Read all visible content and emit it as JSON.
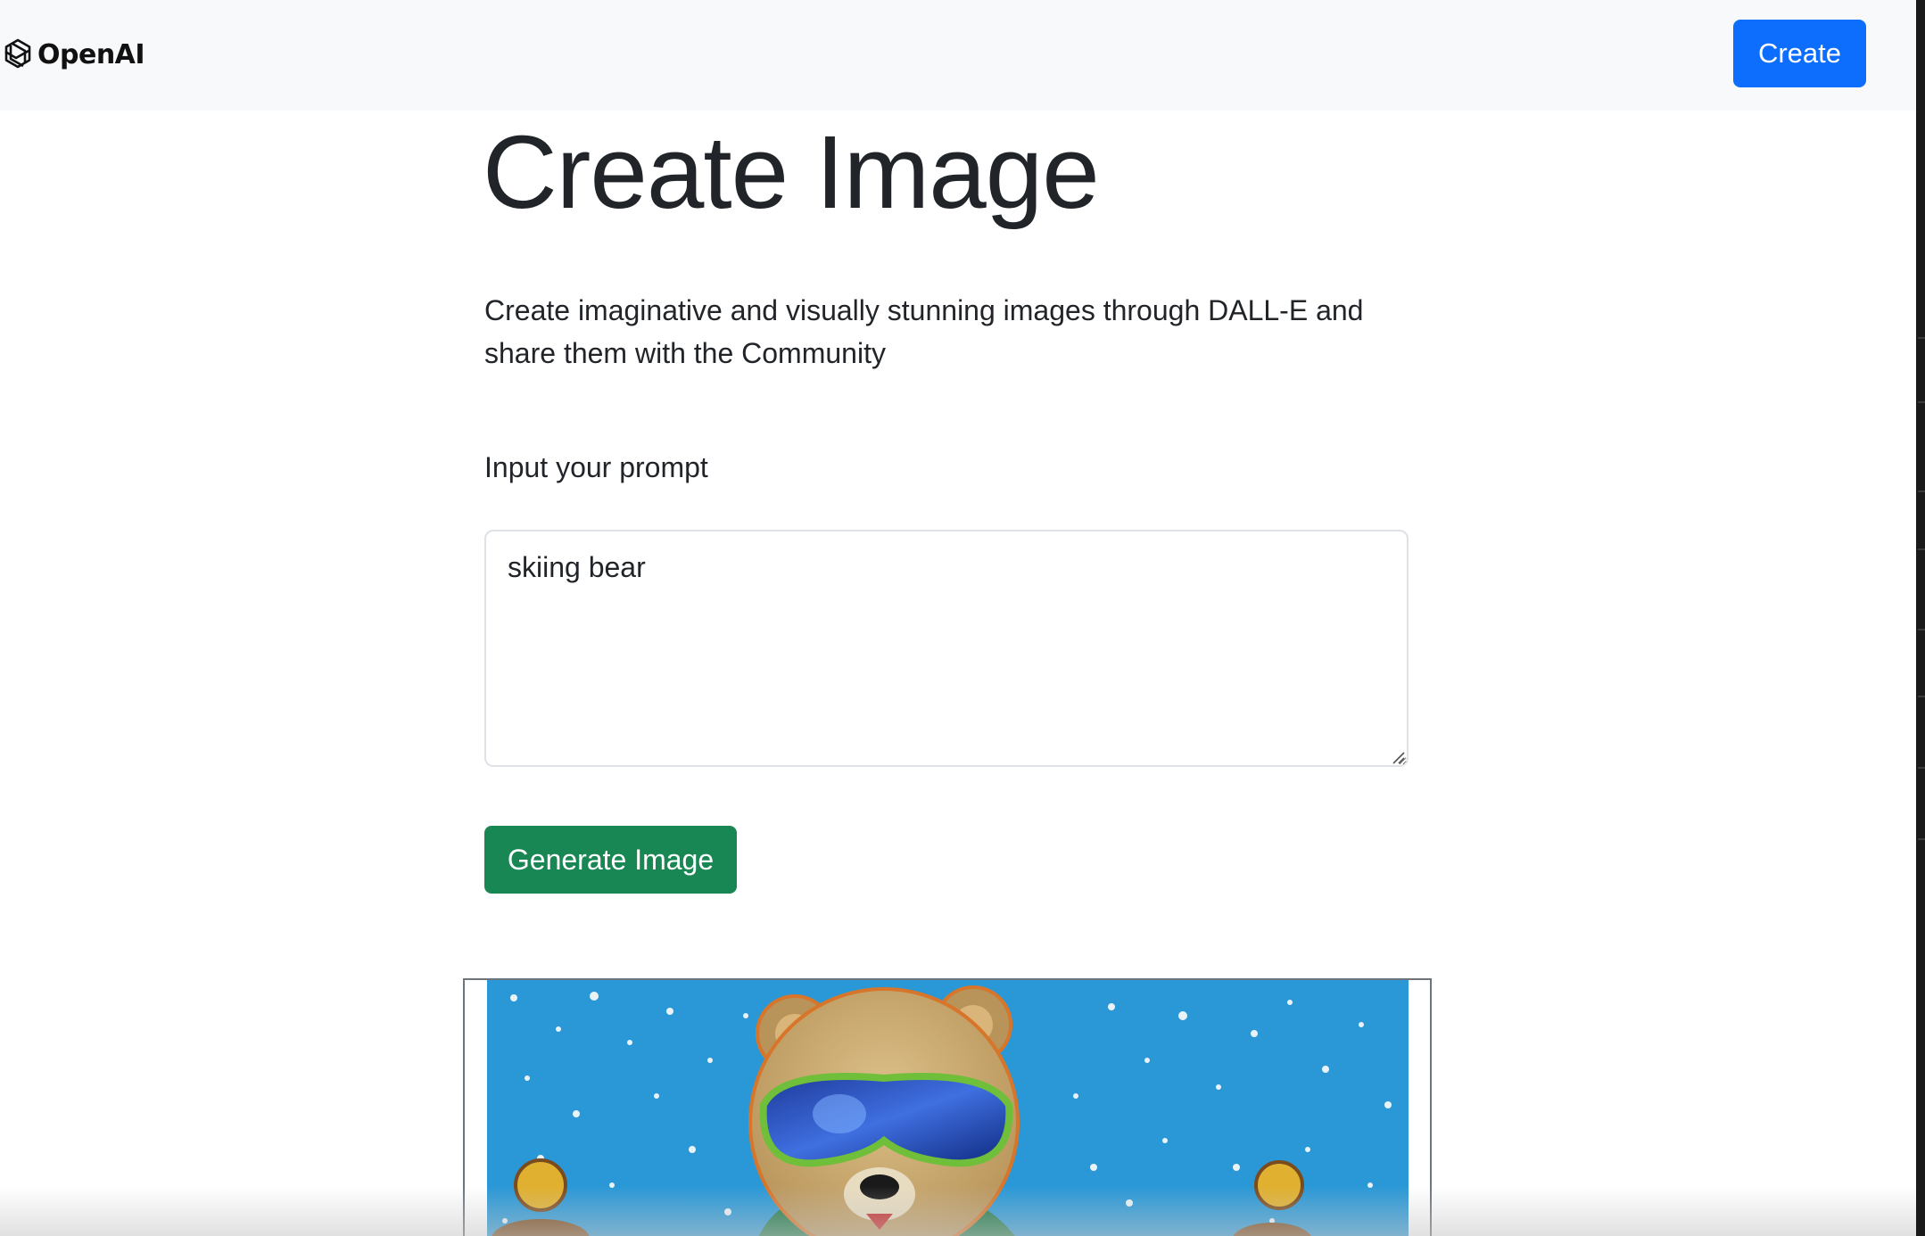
{
  "navbar": {
    "brand_name": "OpenAI",
    "brand_icon": "openai-logo-icon",
    "create_label": "Create",
    "create_color": "#0d6efd"
  },
  "main": {
    "title": "Create Image",
    "description": "Create imaginative and visually stunning images through DALL-E and share them with the Community",
    "prompt_label": "Input your prompt",
    "prompt_value": "skiing bear",
    "generate_label": "Generate Image",
    "generate_color": "#198754"
  },
  "result": {
    "image_subject": "cartoon bear wearing ski goggles in snowfall",
    "image_icon": "generated-image"
  }
}
